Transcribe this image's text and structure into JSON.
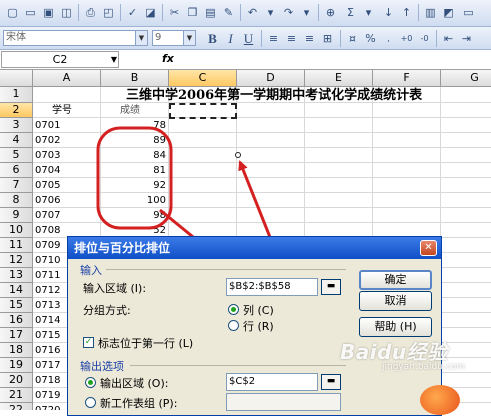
{
  "toolbar2": {
    "font_name": "宋体",
    "font_size": "9",
    "bold": "B",
    "italic": "I",
    "underline": "U",
    "currency": "%",
    "sum_symbol": "Σ"
  },
  "formula_bar": {
    "cell_ref": "C2",
    "fx": "fx",
    "value": ""
  },
  "columns": [
    "A",
    "B",
    "C",
    "D",
    "E",
    "F",
    "G"
  ],
  "rows": [
    "1",
    "2",
    "3",
    "4",
    "5",
    "6",
    "7",
    "8",
    "9",
    "10",
    "11",
    "12",
    "13",
    "14",
    "15",
    "16",
    "17",
    "18",
    "19",
    "20",
    "21",
    "22",
    "23"
  ],
  "sheet": {
    "title": "三维中学2006年第一学期期中考试化学成绩统计表",
    "header_a": "学号",
    "header_b": "成绩",
    "ids": [
      "0701",
      "0702",
      "0703",
      "0704",
      "0705",
      "0706",
      "0707",
      "0708",
      "0709",
      "0710",
      "0711",
      "0712",
      "0713",
      "0714",
      "0715",
      "0716",
      "0717",
      "0718",
      "0719",
      "0720",
      "0721"
    ],
    "scores": [
      "78",
      "89",
      "84",
      "81",
      "92",
      "100",
      "98",
      "52"
    ]
  },
  "dialog": {
    "title": "排位与百分比排位",
    "input_group": "输入",
    "input_range_label": "输入区域 (I):",
    "input_range_value": "$B$2:$B$58",
    "group_by_label": "分组方式:",
    "by_column_label": "列 (C)",
    "by_row_label": "行 (R)",
    "labels_first_row": "标志位于第一行 (L)",
    "output_group": "输出选项",
    "output_range_label": "输出区域 (O):",
    "output_range_value": "$C$2",
    "new_sheet_label": "新工作表组 (P):",
    "ok": "确定",
    "cancel": "取消",
    "help": "帮助 (H)"
  },
  "watermark": {
    "brand": "Baidu经验",
    "url": "jingyan.baidu.com"
  },
  "colors": {
    "annotation": "#d42020",
    "dialog_title": "#1d5ad6",
    "selected_header": "#ffc862"
  }
}
